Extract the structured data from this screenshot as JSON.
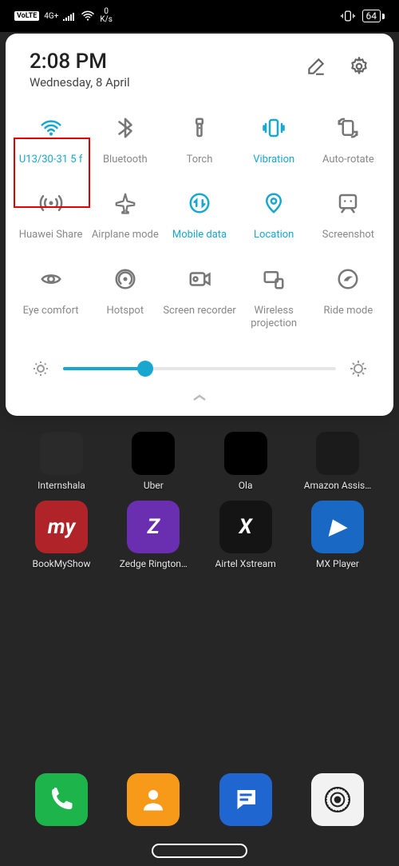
{
  "status": {
    "volte": "VoLTE",
    "net_type": "4G+",
    "net_speed_val": "0",
    "net_speed_unit": "K/s",
    "battery": "64"
  },
  "panel": {
    "time": "2:08 PM",
    "date": "Wednesday, 8 April",
    "brightness_percent": 30,
    "tiles": [
      {
        "id": "wifi",
        "label": "U13/30-31 5 f",
        "active": true
      },
      {
        "id": "bluetooth",
        "label": "Bluetooth",
        "active": false
      },
      {
        "id": "torch",
        "label": "Torch",
        "active": false
      },
      {
        "id": "vibration",
        "label": "Vibration",
        "active": true
      },
      {
        "id": "autorotate",
        "label": "Auto-rotate",
        "active": false
      },
      {
        "id": "huaweishare",
        "label": "Huawei Share",
        "active": false
      },
      {
        "id": "airplane",
        "label": "Airplane mode",
        "active": false
      },
      {
        "id": "mobiledata",
        "label": "Mobile data",
        "active": true
      },
      {
        "id": "location",
        "label": "Location",
        "active": true
      },
      {
        "id": "screenshot",
        "label": "Screenshot",
        "active": false
      },
      {
        "id": "eyecomfort",
        "label": "Eye comfort",
        "active": false
      },
      {
        "id": "hotspot",
        "label": "Hotspot",
        "active": false
      },
      {
        "id": "recorder",
        "label": "Screen recorder",
        "active": false
      },
      {
        "id": "projection",
        "label": "Wireless projection",
        "active": false
      },
      {
        "id": "ridemode",
        "label": "Ride mode",
        "active": false
      }
    ]
  },
  "home": {
    "row1": [
      {
        "label": "Internshala",
        "bg": "#2a2a2a"
      },
      {
        "label": "Uber",
        "bg": "#000"
      },
      {
        "label": "Ola",
        "bg": "#000"
      },
      {
        "label": "Amazon Assis…",
        "bg": "#1b1b1b"
      }
    ],
    "row2": [
      {
        "label": "BookMyShow",
        "bg": "#b02328",
        "glyph": "my"
      },
      {
        "label": "Zedge Rington…",
        "bg": "#6a2fb0",
        "glyph": "Z"
      },
      {
        "label": "Airtel Xstream",
        "bg": "#141414",
        "glyph": "X"
      },
      {
        "label": "MX Player",
        "bg": "#1968c3",
        "glyph": "▶"
      }
    ],
    "dock": [
      {
        "id": "phone",
        "bg": "#1db54b"
      },
      {
        "id": "contacts",
        "bg": "#f79a1a"
      },
      {
        "id": "messages",
        "bg": "#1f66d0"
      },
      {
        "id": "settings",
        "bg": "#f2f2f2"
      }
    ]
  }
}
